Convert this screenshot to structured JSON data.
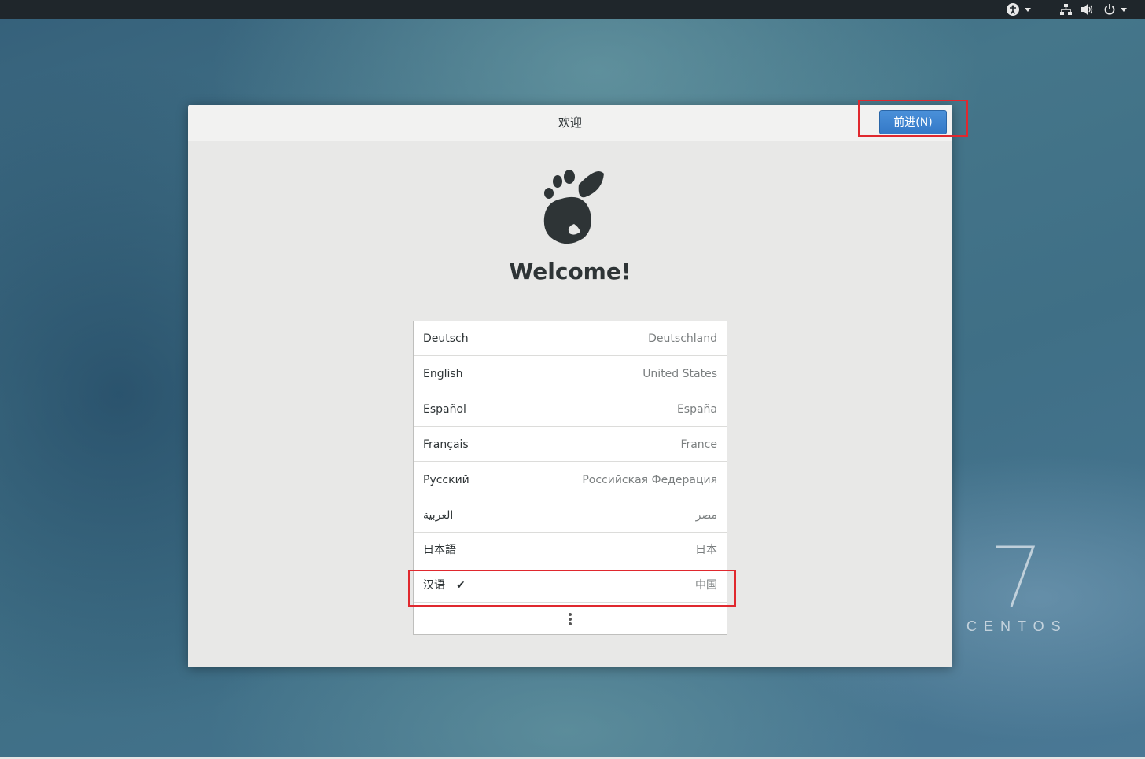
{
  "topbar": {
    "accessibility_icon": "accessibility-icon",
    "network_icon": "network-icon",
    "volume_icon": "volume-icon",
    "power_icon": "power-icon"
  },
  "dialog": {
    "title": "欢迎",
    "next_button": "前进(N)",
    "logo_icon": "gnome-foot-icon",
    "welcome_text": "Welcome!",
    "languages": [
      {
        "name": "Deutsch",
        "region": "Deutschland"
      },
      {
        "name": "English",
        "region": "United States"
      },
      {
        "name": "Español",
        "region": "España"
      },
      {
        "name": "Français",
        "region": "France"
      },
      {
        "name": "Русский",
        "region": "Российская Федерация"
      },
      {
        "name": "العربية",
        "region": "مصر"
      },
      {
        "name": "日本語",
        "region": "日本"
      },
      {
        "name": "汉语",
        "region": "中国",
        "selected": true,
        "check": "✔"
      }
    ],
    "more_icon": "more-vertical-icon"
  },
  "wallpaper": {
    "version": "7",
    "brand": "CENTOS"
  },
  "colors": {
    "accent": "#3479c7",
    "highlight": "#e0282e",
    "topbar": "#1f262b"
  }
}
